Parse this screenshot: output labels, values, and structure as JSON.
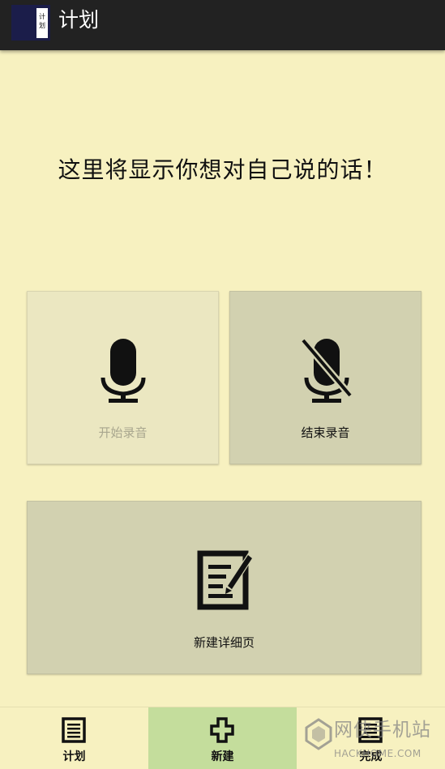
{
  "app_bar": {
    "title": "计划",
    "icon_text": "计划",
    "icon": "app-logo-icon"
  },
  "main": {
    "headline": "这里将显示你想对自己说的话！"
  },
  "tiles": {
    "start_record": {
      "label": "开始录音",
      "icon": "microphone-icon",
      "enabled": false
    },
    "stop_record": {
      "label": "结束录音",
      "icon": "microphone-off-icon",
      "enabled": true
    },
    "new_detail": {
      "label": "新建详细页",
      "icon": "edit-note-icon"
    }
  },
  "bottom_nav": {
    "items": [
      {
        "label": "计划",
        "icon": "list-icon",
        "selected": false
      },
      {
        "label": "新建",
        "icon": "plus-icon",
        "selected": true
      },
      {
        "label": "完成",
        "icon": "done-list-icon",
        "selected": false
      }
    ]
  },
  "watermark": {
    "text_cn": "网侠手机站",
    "text_en": "HACKHOME.COM"
  },
  "colors": {
    "background": "#f7f1c0",
    "app_bar": "#222222",
    "tile": "#d2d1b0",
    "tile_disabled": "#ebe7c1",
    "nav_selected": "#c4dd9c"
  }
}
